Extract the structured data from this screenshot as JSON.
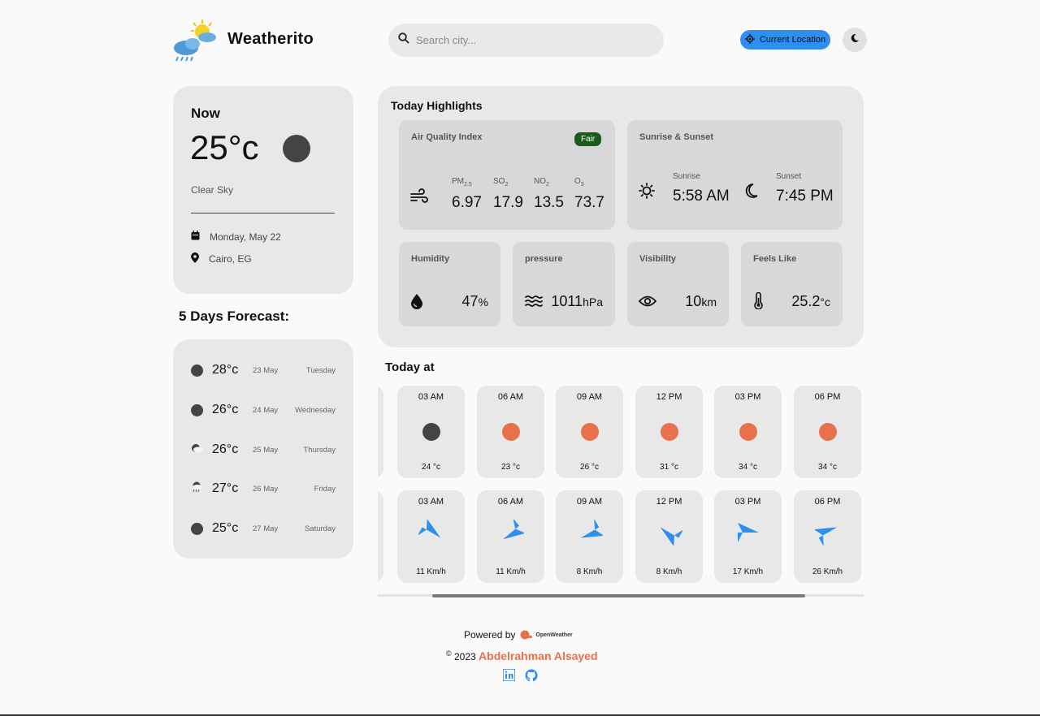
{
  "header": {
    "brand": "Weatherito",
    "search_placeholder": "Search city...",
    "location_button": "Current Location"
  },
  "now": {
    "title": "Now",
    "temperature": "25°c",
    "description": "Clear Sky",
    "date": "Monday, May 22",
    "location": "Cairo, EG"
  },
  "forecast": {
    "title": "5 Days Forecast:",
    "days": [
      {
        "temp": "28°c",
        "date": "23 May",
        "day": "Tuesday",
        "icon": "dark-circle-icon"
      },
      {
        "temp": "26°c",
        "date": "24 May",
        "day": "Wednesday",
        "icon": "dark-circle-icon"
      },
      {
        "temp": "26°c",
        "date": "25 May",
        "day": "Thursday",
        "icon": "partly-cloudy-icon"
      },
      {
        "temp": "27°c",
        "date": "26 May",
        "day": "Friday",
        "icon": "rain-cloud-icon"
      },
      {
        "temp": "25°c",
        "date": "27 May",
        "day": "Saturday",
        "icon": "dark-circle-icon"
      }
    ]
  },
  "highlights": {
    "title": "Today Highlights",
    "air_quality": {
      "label": "Air Quality Index",
      "badge": "Fair",
      "items": [
        {
          "name": "PM",
          "sub": "2.5",
          "value": "6.97"
        },
        {
          "name": "SO",
          "sub": "2",
          "value": "17.9"
        },
        {
          "name": "NO",
          "sub": "2",
          "value": "13.5"
        },
        {
          "name": "O",
          "sub": "3",
          "value": "73.7"
        }
      ]
    },
    "sun": {
      "label": "Sunrise & Sunset",
      "sunrise_label": "Sunrise",
      "sunrise": "5:58 AM",
      "sunset_label": "Sunset",
      "sunset": "7:45 PM"
    },
    "humidity": {
      "label": "Humidity",
      "value": "47",
      "unit": "%"
    },
    "pressure": {
      "label": "pressure",
      "value": "1011",
      "unit": "hPa"
    },
    "visibility": {
      "label": "Visibility",
      "value": "10",
      "unit": "km"
    },
    "feels_like": {
      "label": "Feels Like",
      "value": "25.2",
      "unit": "°c"
    }
  },
  "today_at": {
    "title": "Today at",
    "hourly": [
      {
        "time": "03 AM",
        "temp": "24 °c",
        "icon": "dark-circle-icon"
      },
      {
        "time": "06 AM",
        "temp": "23 °c",
        "icon": "sun-icon"
      },
      {
        "time": "09 AM",
        "temp": "26 °c",
        "icon": "sun-icon"
      },
      {
        "time": "12 PM",
        "temp": "31 °c",
        "icon": "sun-icon"
      },
      {
        "time": "03 PM",
        "temp": "34 °c",
        "icon": "sun-icon"
      },
      {
        "time": "06 PM",
        "temp": "34 °c",
        "icon": "sun-icon"
      }
    ],
    "wind": [
      {
        "time": "03 AM",
        "speed": "11 Km/h",
        "direction_deg": 30
      },
      {
        "time": "06 AM",
        "speed": "11 Km/h",
        "direction_deg": 140
      },
      {
        "time": "09 AM",
        "speed": "8 Km/h",
        "direction_deg": 150
      },
      {
        "time": "12 PM",
        "speed": "8 Km/h",
        "direction_deg": 210
      },
      {
        "time": "03 PM",
        "speed": "17 Km/h",
        "direction_deg": 0
      },
      {
        "time": "06 PM",
        "speed": "26 Km/h",
        "direction_deg": 330
      }
    ]
  },
  "footer": {
    "powered_by": "Powered by",
    "provider": "OpenWeather",
    "copyright_symbol": "©",
    "year": "2023",
    "author": "Abdelrahman Alsayed"
  },
  "colors": {
    "accent_blue": "#2d8ff0",
    "sun_orange": "#e8704a",
    "dark_icon": "#444444",
    "fair_badge": "#1a5c1a"
  }
}
